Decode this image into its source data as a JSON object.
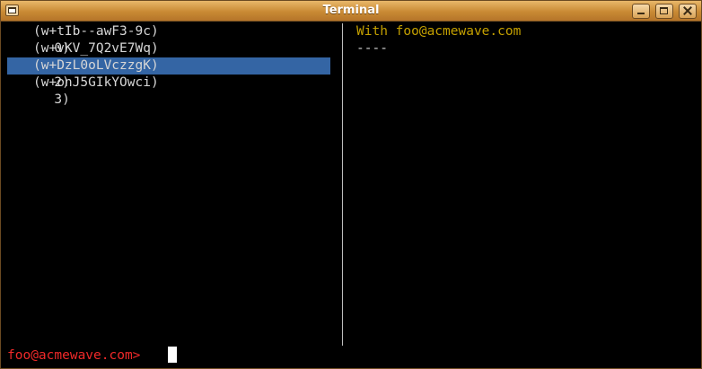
{
  "window": {
    "title": "Terminal"
  },
  "list": {
    "items": [
      {
        "index": "0)",
        "text": "(w+tIb--awF3-9c)",
        "selected": false
      },
      {
        "index": "1)",
        "text": "(w+vKV_7Q2vE7Wq)",
        "selected": false
      },
      {
        "index": "2)",
        "text": "(w+DzL0oLVczzgK)",
        "selected": true
      },
      {
        "index": "3)",
        "text": "(w+onJ5GIkYOwci)",
        "selected": false
      }
    ]
  },
  "preview": {
    "title": "With foo@acmewave.com",
    "rule": "----"
  },
  "prompt": {
    "text": "foo@acmewave.com>"
  },
  "colors": {
    "selection": "#3465a4",
    "prompt": "#ef2929",
    "preview_title": "#c4a000",
    "titlebar": "#d9a356"
  }
}
